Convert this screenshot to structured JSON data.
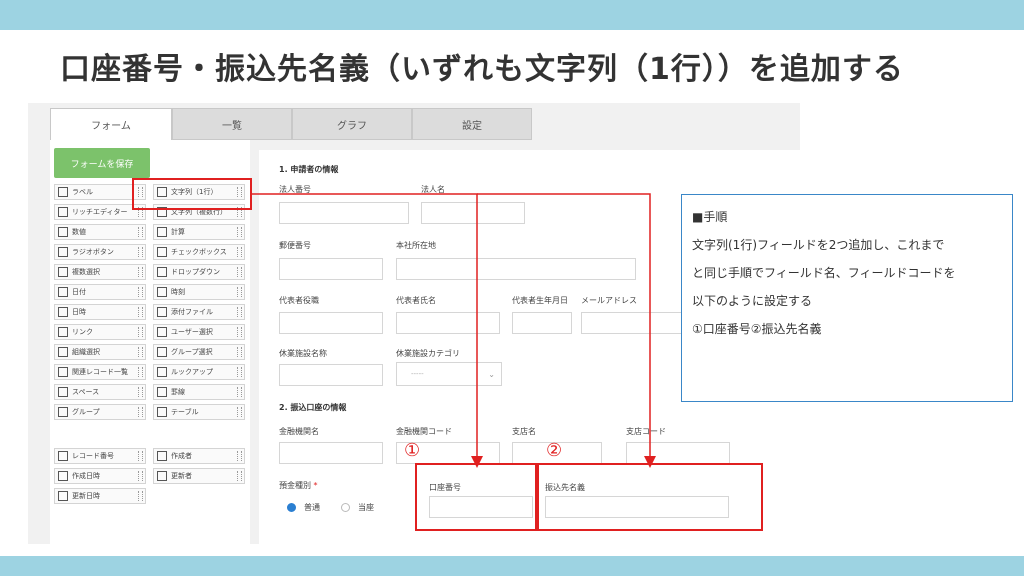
{
  "slide": {
    "title": "口座番号・振込先名義（いずれも文字列（1行））を追加する"
  },
  "tabs": [
    {
      "label": "フォーム"
    },
    {
      "label": "一覧"
    },
    {
      "label": "グラフ"
    },
    {
      "label": "設定"
    }
  ],
  "toolbox": {
    "save_label": "フォームを保存",
    "items": [
      {
        "label": "ラベル",
        "icon": "tag-icon"
      },
      {
        "label": "文字列（1行）",
        "icon": "text-line-icon"
      },
      {
        "label": "リッチエディター",
        "icon": "rich-editor-icon"
      },
      {
        "label": "文字列（複数行）",
        "icon": "text-multiline-icon"
      },
      {
        "label": "数値",
        "icon": "number-icon"
      },
      {
        "label": "計算",
        "icon": "calculator-icon"
      },
      {
        "label": "ラジオボタン",
        "icon": "radio-icon"
      },
      {
        "label": "チェックボックス",
        "icon": "checkbox-icon"
      },
      {
        "label": "複数選択",
        "icon": "multi-select-icon"
      },
      {
        "label": "ドロップダウン",
        "icon": "dropdown-icon"
      },
      {
        "label": "日付",
        "icon": "date-icon"
      },
      {
        "label": "時刻",
        "icon": "clock-icon"
      },
      {
        "label": "日時",
        "icon": "datetime-icon"
      },
      {
        "label": "添付ファイル",
        "icon": "attachment-icon"
      },
      {
        "label": "リンク",
        "icon": "link-icon"
      },
      {
        "label": "ユーザー選択",
        "icon": "user-icon"
      },
      {
        "label": "組織選択",
        "icon": "org-icon"
      },
      {
        "label": "グループ選択",
        "icon": "group-icon"
      },
      {
        "label": "関連レコード一覧",
        "icon": "related-records-icon"
      },
      {
        "label": "ルックアップ",
        "icon": "lookup-icon"
      },
      {
        "label": "スペース",
        "icon": "space-icon"
      },
      {
        "label": "罫線",
        "icon": "rule-line-icon"
      },
      {
        "label": "グループ",
        "icon": "group-folder-icon"
      },
      {
        "label": "テーブル",
        "icon": "table-icon"
      },
      {
        "label": "レコード番号",
        "icon": "record-number-icon"
      },
      {
        "label": "作成者",
        "icon": "creator-icon"
      },
      {
        "label": "作成日時",
        "icon": "created-date-icon"
      },
      {
        "label": "更新者",
        "icon": "updater-icon"
      },
      {
        "label": "更新日時",
        "icon": "updated-date-icon"
      }
    ]
  },
  "form": {
    "section1": "1. 申請者の情報",
    "section2": "2. 振込口座の情報",
    "fields": {
      "corp_number": "法人番号",
      "corp_name": "法人名",
      "postal": "郵便番号",
      "address": "本社所在地",
      "rep_title": "代表者役職",
      "rep_name": "代表者氏名",
      "rep_birth": "代表者生年月日",
      "email": "メールアドレス",
      "facility": "休業施設名称",
      "facility_cat": "休業施設カテゴリ",
      "bank_name": "金融機関名",
      "bank_code": "金融機関コード",
      "branch": "支店名",
      "branch_code": "支店コード",
      "deposit_type": "預金種別",
      "required_mark": "*",
      "account_no": "口座番号",
      "account_holder": "振込先名義"
    },
    "facility_cat_value": "-----",
    "radio_futsu": "普通",
    "radio_toza": "当座",
    "marker1": "①",
    "marker2": "②"
  },
  "callout": {
    "heading": "■手順",
    "line1": "文字列(1行)フィールドを2つ追加し、これまで",
    "line2": "と同じ手順でフィールド名、フィールドコードを",
    "line3": "以下のように設定する",
    "line4": "①口座番号②振込先名義"
  },
  "colors": {
    "accent_bar": "#9dd3e2",
    "highlight": "#e02020",
    "save_button": "#7cc26b",
    "callout_border": "#3a87c8"
  }
}
